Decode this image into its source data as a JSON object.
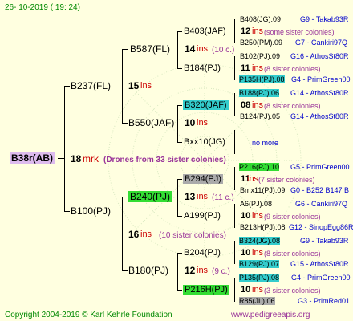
{
  "header": {
    "date": "26- 10-2019 ( 19: 24)"
  },
  "footer": {
    "copyright": "Copyright 2004-2019 © Karl Kehrle Foundation",
    "site": "www.pedigreeapis.org"
  },
  "root": {
    "id": "B38r(AB)",
    "gen": "18",
    "type": "mrk",
    "note": "(Drones from 33 sister colonies)"
  },
  "g1": [
    {
      "id": "B237(FL)",
      "gen": "15",
      "type": "ins",
      "note": ""
    },
    {
      "id": "B100(PJ)",
      "gen": "16",
      "type": "ins",
      "note": "(10 sister colonies)"
    }
  ],
  "g2": [
    {
      "id": "B587(FL)",
      "gen": "14",
      "type": "ins",
      "note": "(10 c.)"
    },
    {
      "id": "B550(JAF)",
      "gen": "10",
      "type": "ins",
      "note": ""
    },
    {
      "id": "B240(PJ)",
      "gen": "13",
      "type": "ins",
      "note": "(11 c.)"
    },
    {
      "id": "B180(PJ)",
      "gen": "12",
      "type": "ins",
      "note": "(9 c.)"
    }
  ],
  "g3": [
    {
      "id": "B403(JAF)",
      "gen": "12",
      "type": "ins",
      "note": "(some sister colonies)"
    },
    {
      "id": "B184(PJ)",
      "gen": "11",
      "type": "ins",
      "note": "(8 sister colonies)"
    },
    {
      "id": "B320(JAF)",
      "gen": "08",
      "type": "ins",
      "note": "(8 sister colonies)"
    },
    {
      "id": "Bxx10(JG)",
      "gen": "",
      "type": "",
      "note": "no more"
    },
    {
      "id": "B294(PJ)",
      "gen": "11",
      "type": "ins",
      "note": "(7 sister colonies)"
    },
    {
      "id": "A199(PJ)",
      "gen": "10",
      "type": "ins",
      "note": "(9 sister colonies)"
    },
    {
      "id": "B204(PJ)",
      "gen": "10",
      "type": "ins",
      "note": "(8 sister colonies)"
    },
    {
      "id": "P216H(PJ)",
      "gen": "10",
      "type": "ins",
      "note": "(3 sister colonies)"
    }
  ],
  "g4": [
    {
      "id": "B408(JG).09",
      "right": "G9 - Takab93R"
    },
    {
      "id": "B250(PM).09",
      "right": "G7 - Cankiri97Q"
    },
    {
      "id": "B102(PJ).09",
      "right": "G16 - AthosSt80R"
    },
    {
      "id": "P135H(PJ).08",
      "right": "G4 - PrimGreen00"
    },
    {
      "id": "B188(PJ).06",
      "right": "G14 - AthosSt80R"
    },
    {
      "id": "B124(PJ).05",
      "right": "G14 - AthosSt80R"
    },
    {
      "id": "P216(PJ).10",
      "right": "G5 - PrimGreen00"
    },
    {
      "id": "Bmx11(PJ).09",
      "right": "G0 - B252 B147 B"
    },
    {
      "id": "A6(PJ).08",
      "right": "G6 - Cankiri97Q"
    },
    {
      "id": "B213H(PJ).08",
      "right": "G12 - SinopEgg86R"
    },
    {
      "id": "B324(JG).08",
      "right": "G9 - Takab93R"
    },
    {
      "id": "B129(PJ).07",
      "right": "G15 - AthosSt80R"
    },
    {
      "id": "P135(PJ).08",
      "right": "G4 - PrimGreen00"
    },
    {
      "id": "R85(JL).06",
      "right": "G3 - PrimRed01"
    }
  ]
}
